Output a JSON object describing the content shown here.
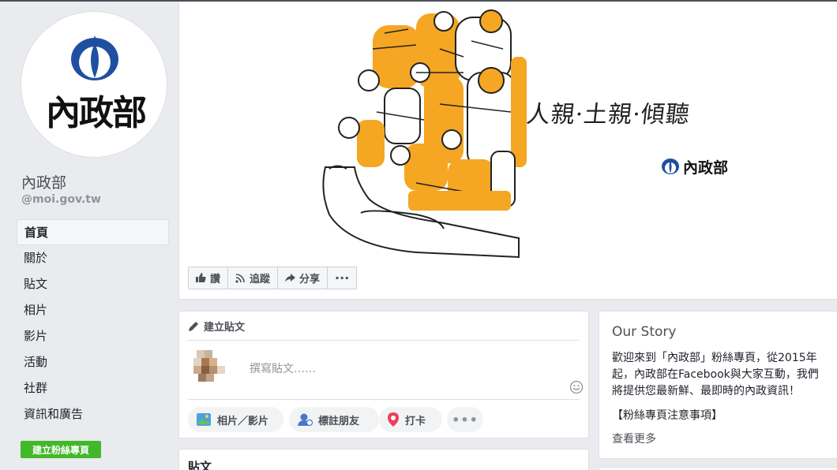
{
  "colors": {
    "accent_orange": "#f5a623",
    "brand_blue": "#1f4fa0",
    "create_green": "#42b72a"
  },
  "profile": {
    "logo_text": "內政部",
    "name": "內政部",
    "handle": "@moi.gov.tw"
  },
  "sidebar": {
    "items": [
      {
        "label": "首頁",
        "active": true
      },
      {
        "label": "關於"
      },
      {
        "label": "貼文"
      },
      {
        "label": "相片"
      },
      {
        "label": "影片"
      },
      {
        "label": "活動"
      },
      {
        "label": "社群"
      },
      {
        "label": "資訊和廣告"
      }
    ],
    "create_page_label": "建立粉絲專頁"
  },
  "cover": {
    "slogan": "人親·土親·傾聽",
    "logo_text": "內政部"
  },
  "actions": {
    "like": "讚",
    "follow": "追蹤",
    "share": "分享",
    "more": "···"
  },
  "create_post": {
    "title": "建立貼文",
    "placeholder": "撰寫貼文……",
    "photo_label": "相片／影片",
    "tag_label": "標註朋友",
    "checkin_label": "打卡",
    "more_label": "•••"
  },
  "posts": {
    "title": "貼文"
  },
  "story": {
    "title": "Our Story",
    "body": "歡迎來到「內政部」粉絲專頁，從2015年\n起，內政部在Facebook與大家互動，我們\n將提供您最新鮮、最即時的內政資訊！",
    "note": "【粉絲專頁注意事項】",
    "more_label": "查看更多"
  }
}
